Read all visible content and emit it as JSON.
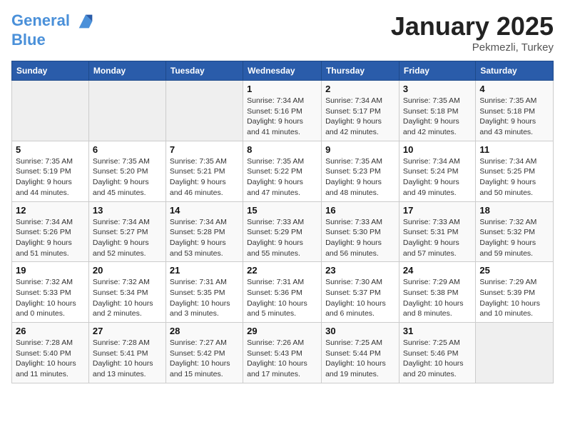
{
  "header": {
    "logo_line1": "General",
    "logo_line2": "Blue",
    "month": "January 2025",
    "location": "Pekmezli, Turkey"
  },
  "weekdays": [
    "Sunday",
    "Monday",
    "Tuesday",
    "Wednesday",
    "Thursday",
    "Friday",
    "Saturday"
  ],
  "weeks": [
    [
      {
        "day": "",
        "info": ""
      },
      {
        "day": "",
        "info": ""
      },
      {
        "day": "",
        "info": ""
      },
      {
        "day": "1",
        "info": "Sunrise: 7:34 AM\nSunset: 5:16 PM\nDaylight: 9 hours\nand 41 minutes."
      },
      {
        "day": "2",
        "info": "Sunrise: 7:34 AM\nSunset: 5:17 PM\nDaylight: 9 hours\nand 42 minutes."
      },
      {
        "day": "3",
        "info": "Sunrise: 7:35 AM\nSunset: 5:18 PM\nDaylight: 9 hours\nand 42 minutes."
      },
      {
        "day": "4",
        "info": "Sunrise: 7:35 AM\nSunset: 5:18 PM\nDaylight: 9 hours\nand 43 minutes."
      }
    ],
    [
      {
        "day": "5",
        "info": "Sunrise: 7:35 AM\nSunset: 5:19 PM\nDaylight: 9 hours\nand 44 minutes."
      },
      {
        "day": "6",
        "info": "Sunrise: 7:35 AM\nSunset: 5:20 PM\nDaylight: 9 hours\nand 45 minutes."
      },
      {
        "day": "7",
        "info": "Sunrise: 7:35 AM\nSunset: 5:21 PM\nDaylight: 9 hours\nand 46 minutes."
      },
      {
        "day": "8",
        "info": "Sunrise: 7:35 AM\nSunset: 5:22 PM\nDaylight: 9 hours\nand 47 minutes."
      },
      {
        "day": "9",
        "info": "Sunrise: 7:35 AM\nSunset: 5:23 PM\nDaylight: 9 hours\nand 48 minutes."
      },
      {
        "day": "10",
        "info": "Sunrise: 7:34 AM\nSunset: 5:24 PM\nDaylight: 9 hours\nand 49 minutes."
      },
      {
        "day": "11",
        "info": "Sunrise: 7:34 AM\nSunset: 5:25 PM\nDaylight: 9 hours\nand 50 minutes."
      }
    ],
    [
      {
        "day": "12",
        "info": "Sunrise: 7:34 AM\nSunset: 5:26 PM\nDaylight: 9 hours\nand 51 minutes."
      },
      {
        "day": "13",
        "info": "Sunrise: 7:34 AM\nSunset: 5:27 PM\nDaylight: 9 hours\nand 52 minutes."
      },
      {
        "day": "14",
        "info": "Sunrise: 7:34 AM\nSunset: 5:28 PM\nDaylight: 9 hours\nand 53 minutes."
      },
      {
        "day": "15",
        "info": "Sunrise: 7:33 AM\nSunset: 5:29 PM\nDaylight: 9 hours\nand 55 minutes."
      },
      {
        "day": "16",
        "info": "Sunrise: 7:33 AM\nSunset: 5:30 PM\nDaylight: 9 hours\nand 56 minutes."
      },
      {
        "day": "17",
        "info": "Sunrise: 7:33 AM\nSunset: 5:31 PM\nDaylight: 9 hours\nand 57 minutes."
      },
      {
        "day": "18",
        "info": "Sunrise: 7:32 AM\nSunset: 5:32 PM\nDaylight: 9 hours\nand 59 minutes."
      }
    ],
    [
      {
        "day": "19",
        "info": "Sunrise: 7:32 AM\nSunset: 5:33 PM\nDaylight: 10 hours\nand 0 minutes."
      },
      {
        "day": "20",
        "info": "Sunrise: 7:32 AM\nSunset: 5:34 PM\nDaylight: 10 hours\nand 2 minutes."
      },
      {
        "day": "21",
        "info": "Sunrise: 7:31 AM\nSunset: 5:35 PM\nDaylight: 10 hours\nand 3 minutes."
      },
      {
        "day": "22",
        "info": "Sunrise: 7:31 AM\nSunset: 5:36 PM\nDaylight: 10 hours\nand 5 minutes."
      },
      {
        "day": "23",
        "info": "Sunrise: 7:30 AM\nSunset: 5:37 PM\nDaylight: 10 hours\nand 6 minutes."
      },
      {
        "day": "24",
        "info": "Sunrise: 7:29 AM\nSunset: 5:38 PM\nDaylight: 10 hours\nand 8 minutes."
      },
      {
        "day": "25",
        "info": "Sunrise: 7:29 AM\nSunset: 5:39 PM\nDaylight: 10 hours\nand 10 minutes."
      }
    ],
    [
      {
        "day": "26",
        "info": "Sunrise: 7:28 AM\nSunset: 5:40 PM\nDaylight: 10 hours\nand 11 minutes."
      },
      {
        "day": "27",
        "info": "Sunrise: 7:28 AM\nSunset: 5:41 PM\nDaylight: 10 hours\nand 13 minutes."
      },
      {
        "day": "28",
        "info": "Sunrise: 7:27 AM\nSunset: 5:42 PM\nDaylight: 10 hours\nand 15 minutes."
      },
      {
        "day": "29",
        "info": "Sunrise: 7:26 AM\nSunset: 5:43 PM\nDaylight: 10 hours\nand 17 minutes."
      },
      {
        "day": "30",
        "info": "Sunrise: 7:25 AM\nSunset: 5:44 PM\nDaylight: 10 hours\nand 19 minutes."
      },
      {
        "day": "31",
        "info": "Sunrise: 7:25 AM\nSunset: 5:46 PM\nDaylight: 10 hours\nand 20 minutes."
      },
      {
        "day": "",
        "info": ""
      }
    ]
  ]
}
